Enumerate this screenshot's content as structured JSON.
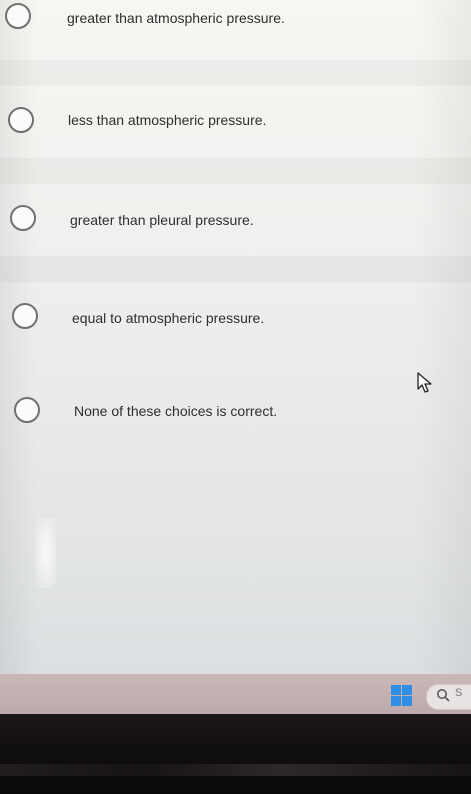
{
  "question": {
    "options": [
      {
        "label": "greater than atmospheric pressure.",
        "selected": false
      },
      {
        "label": "less than atmospheric pressure.",
        "selected": false
      },
      {
        "label": "greater than pleural pressure.",
        "selected": false
      },
      {
        "label": "equal to atmospheric pressure.",
        "selected": false
      },
      {
        "label": "None of these choices is correct.",
        "selected": false
      }
    ]
  },
  "taskbar": {
    "start_icon": "windows-logo",
    "search_icon": "search-icon",
    "search_text": "S"
  },
  "colors": {
    "radio_border": "#707070",
    "text": "#2e2e2e",
    "windows_blue": "#2f8fe6",
    "taskbar": "#c9b8b8"
  }
}
